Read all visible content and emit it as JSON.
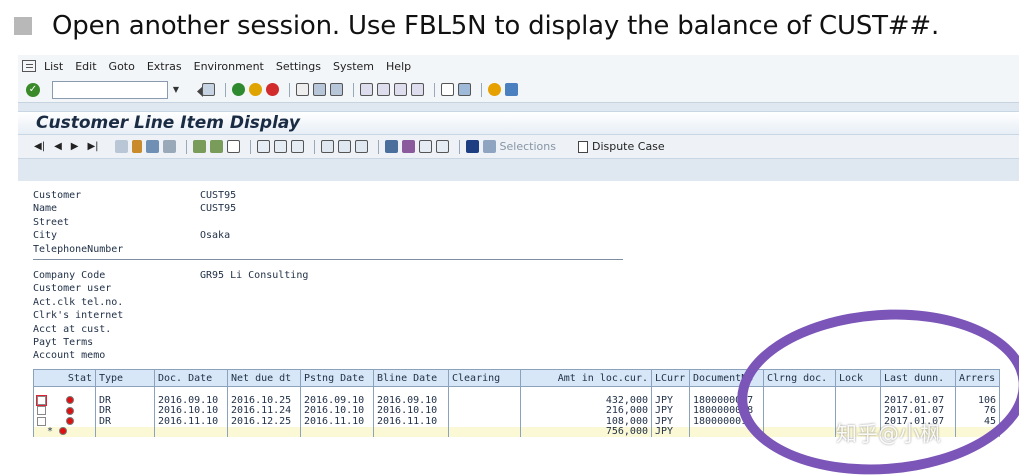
{
  "instruction": "Open another session. Use FBL5N to display the balance of CUST##.",
  "menu": [
    "List",
    "Edit",
    "Goto",
    "Extras",
    "Environment",
    "Settings",
    "System",
    "Help"
  ],
  "colors": {
    "status_red": "#dd1111",
    "title_bg": "#e7eef6",
    "header_cell": "#d7e7f7",
    "sum_row": "#fbf8d5",
    "annotation_ellipse": "#7b55b8"
  },
  "title": "Customer Line Item Display",
  "toolbar": {
    "selections_label": "Selections",
    "dispute_label": "Dispute Case"
  },
  "header_fields": [
    {
      "label": "Customer",
      "value": "CUST95"
    },
    {
      "label": "Name",
      "value": "CUST95"
    },
    {
      "label": "Street",
      "value": ""
    },
    {
      "label": "City",
      "value": "Osaka"
    },
    {
      "label": "TelephoneNumber",
      "value": ""
    }
  ],
  "company_fields": [
    {
      "label": "Company Code",
      "value": "GR95 Li Consulting"
    },
    {
      "label": "Customer user",
      "value": ""
    },
    {
      "label": "Act.clk tel.no.",
      "value": ""
    },
    {
      "label": "Clrk's internet",
      "value": ""
    },
    {
      "label": "Acct at cust.",
      "value": ""
    },
    {
      "label": "Payt Terms",
      "value": ""
    },
    {
      "label": "Account memo",
      "value": ""
    }
  ],
  "table": {
    "columns": [
      "Stat",
      "Type",
      "Doc. Date",
      "Net due dt",
      "Pstng Date",
      "Bline Date",
      "Clearing",
      "Amt in loc.cur.",
      "LCurr",
      "DocumentNo",
      "Clrng doc.",
      "Lock",
      "Last dunn.",
      "Arrers"
    ],
    "rows": [
      {
        "type": "DR",
        "doc_date": "2016.09.10",
        "net_due": "2016.10.25",
        "pstng": "2016.09.10",
        "bline": "2016.09.10",
        "clearing": "",
        "amount": "432,000",
        "curr": "JPY",
        "docno": "1800000017",
        "clrng": "",
        "lock": "",
        "last_dunn": "2017.01.07",
        "arrears": "106"
      },
      {
        "type": "DR",
        "doc_date": "2016.10.10",
        "net_due": "2016.11.24",
        "pstng": "2016.10.10",
        "bline": "2016.10.10",
        "clearing": "",
        "amount": "216,000",
        "curr": "JPY",
        "docno": "1800000018",
        "clrng": "",
        "lock": "",
        "last_dunn": "2017.01.07",
        "arrears": "76"
      },
      {
        "type": "DR",
        "doc_date": "2016.11.10",
        "net_due": "2016.12.25",
        "pstng": "2016.11.10",
        "bline": "2016.11.10",
        "clearing": "",
        "amount": "108,000",
        "curr": "JPY",
        "docno": "1800000019",
        "clrng": "",
        "lock": "",
        "last_dunn": "2017.01.07",
        "arrears": "45"
      }
    ],
    "total": {
      "marker": "*",
      "amount": "756,000",
      "curr": "JPY"
    }
  },
  "watermark": "知乎@小枫"
}
